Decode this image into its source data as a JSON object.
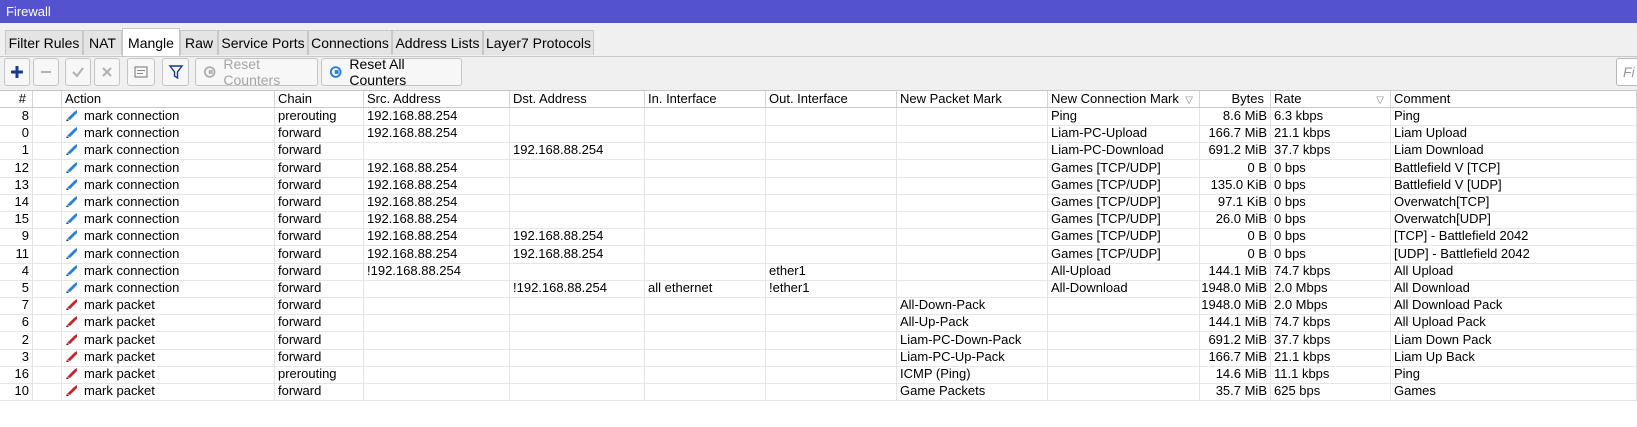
{
  "window": {
    "title": "Firewall"
  },
  "tabs": [
    {
      "label": "Filter Rules",
      "active": false
    },
    {
      "label": "NAT",
      "active": false
    },
    {
      "label": "Mangle",
      "active": true
    },
    {
      "label": "Raw",
      "active": false
    },
    {
      "label": "Service Ports",
      "active": false
    },
    {
      "label": "Connections",
      "active": false
    },
    {
      "label": "Address Lists",
      "active": false
    },
    {
      "label": "Layer7 Protocols",
      "active": false
    }
  ],
  "toolbar": {
    "add_icon": "plus-icon",
    "remove_icon": "minus-icon",
    "enable_icon": "check-icon",
    "disable_icon": "cross-icon",
    "comment_icon": "comment-icon",
    "filter_icon": "filter-icon",
    "reset_counters_label": "Reset Counters",
    "reset_all_counters_label": "Reset All Counters",
    "search_placeholder": "Fi"
  },
  "colors": {
    "titlebar": "#5552cf",
    "accent_blue": "#1a3a8a",
    "connection_icon": "#2b7fd4",
    "packet_icon": "#c0272d"
  },
  "table": {
    "columns": [
      "#",
      "",
      "Action",
      "Chain",
      "Src. Address",
      "Dst. Address",
      "In. Interface",
      "Out. Interface",
      "New Packet Mark",
      "New Connection Mark",
      "Bytes",
      "Rate",
      "Comment"
    ],
    "rows": [
      {
        "num": "8",
        "icon": "connection",
        "action": "mark connection",
        "chain": "prerouting",
        "src": "192.168.88.254",
        "dst": "",
        "in_if": "",
        "out_if": "",
        "pkt_mark": "",
        "conn_mark": "Ping",
        "bytes": "8.6 MiB",
        "rate": "6.3 kbps",
        "comment": "Ping"
      },
      {
        "num": "0",
        "icon": "connection",
        "action": "mark connection",
        "chain": "forward",
        "src": "192.168.88.254",
        "dst": "",
        "in_if": "",
        "out_if": "",
        "pkt_mark": "",
        "conn_mark": "Liam-PC-Upload",
        "bytes": "166.7 MiB",
        "rate": "21.1 kbps",
        "comment": "Liam Upload"
      },
      {
        "num": "1",
        "icon": "connection",
        "action": "mark connection",
        "chain": "forward",
        "src": "",
        "dst": "192.168.88.254",
        "in_if": "",
        "out_if": "",
        "pkt_mark": "",
        "conn_mark": "Liam-PC-Download",
        "bytes": "691.2 MiB",
        "rate": "37.7 kbps",
        "comment": "Liam Download"
      },
      {
        "num": "12",
        "icon": "connection",
        "action": "mark connection",
        "chain": "forward",
        "src": "192.168.88.254",
        "dst": "",
        "in_if": "",
        "out_if": "",
        "pkt_mark": "",
        "conn_mark": "Games [TCP/UDP]",
        "bytes": "0 B",
        "rate": "0 bps",
        "comment": "Battlefield V [TCP]"
      },
      {
        "num": "13",
        "icon": "connection",
        "action": "mark connection",
        "chain": "forward",
        "src": "192.168.88.254",
        "dst": "",
        "in_if": "",
        "out_if": "",
        "pkt_mark": "",
        "conn_mark": "Games [TCP/UDP]",
        "bytes": "135.0 KiB",
        "rate": "0 bps",
        "comment": "Battlefield V [UDP]"
      },
      {
        "num": "14",
        "icon": "connection",
        "action": "mark connection",
        "chain": "forward",
        "src": "192.168.88.254",
        "dst": "",
        "in_if": "",
        "out_if": "",
        "pkt_mark": "",
        "conn_mark": "Games [TCP/UDP]",
        "bytes": "97.1 KiB",
        "rate": "0 bps",
        "comment": "Overwatch[TCP]"
      },
      {
        "num": "15",
        "icon": "connection",
        "action": "mark connection",
        "chain": "forward",
        "src": "192.168.88.254",
        "dst": "",
        "in_if": "",
        "out_if": "",
        "pkt_mark": "",
        "conn_mark": "Games [TCP/UDP]",
        "bytes": "26.0 MiB",
        "rate": "0 bps",
        "comment": "Overwatch[UDP]"
      },
      {
        "num": "9",
        "icon": "connection",
        "action": "mark connection",
        "chain": "forward",
        "src": "192.168.88.254",
        "dst": "192.168.88.254",
        "in_if": "",
        "out_if": "",
        "pkt_mark": "",
        "conn_mark": "Games [TCP/UDP]",
        "bytes": "0 B",
        "rate": "0 bps",
        "comment": "[TCP] - Battlefield 2042"
      },
      {
        "num": "11",
        "icon": "connection",
        "action": "mark connection",
        "chain": "forward",
        "src": "192.168.88.254",
        "dst": "192.168.88.254",
        "in_if": "",
        "out_if": "",
        "pkt_mark": "",
        "conn_mark": "Games [TCP/UDP]",
        "bytes": "0 B",
        "rate": "0 bps",
        "comment": "[UDP] - Battlefield 2042"
      },
      {
        "num": "4",
        "icon": "connection",
        "action": "mark connection",
        "chain": "forward",
        "src": "!192.168.88.254",
        "dst": "",
        "in_if": "",
        "out_if": "ether1",
        "pkt_mark": "",
        "conn_mark": "All-Upload",
        "bytes": "144.1 MiB",
        "rate": "74.7 kbps",
        "comment": "All Upload"
      },
      {
        "num": "5",
        "icon": "connection",
        "action": "mark connection",
        "chain": "forward",
        "src": "",
        "dst": "!192.168.88.254",
        "in_if": "all ethernet",
        "out_if": "!ether1",
        "pkt_mark": "",
        "conn_mark": "All-Download",
        "bytes": "1948.0 MiB",
        "rate": "2.0 Mbps",
        "comment": "All Download"
      },
      {
        "num": "7",
        "icon": "packet",
        "action": "mark packet",
        "chain": "forward",
        "src": "",
        "dst": "",
        "in_if": "",
        "out_if": "",
        "pkt_mark": "All-Down-Pack",
        "conn_mark": "",
        "bytes": "1948.0 MiB",
        "rate": "2.0 Mbps",
        "comment": "All Download Pack"
      },
      {
        "num": "6",
        "icon": "packet",
        "action": "mark packet",
        "chain": "forward",
        "src": "",
        "dst": "",
        "in_if": "",
        "out_if": "",
        "pkt_mark": "All-Up-Pack",
        "conn_mark": "",
        "bytes": "144.1 MiB",
        "rate": "74.7 kbps",
        "comment": "All Upload Pack"
      },
      {
        "num": "2",
        "icon": "packet",
        "action": "mark packet",
        "chain": "forward",
        "src": "",
        "dst": "",
        "in_if": "",
        "out_if": "",
        "pkt_mark": "Liam-PC-Down-Pack",
        "conn_mark": "",
        "bytes": "691.2 MiB",
        "rate": "37.7 kbps",
        "comment": "Liam Down Pack"
      },
      {
        "num": "3",
        "icon": "packet",
        "action": "mark packet",
        "chain": "forward",
        "src": "",
        "dst": "",
        "in_if": "",
        "out_if": "",
        "pkt_mark": "Liam-PC-Up-Pack",
        "conn_mark": "",
        "bytes": "166.7 MiB",
        "rate": "21.1 kbps",
        "comment": "Liam Up Back"
      },
      {
        "num": "16",
        "icon": "packet",
        "action": "mark packet",
        "chain": "prerouting",
        "src": "",
        "dst": "",
        "in_if": "",
        "out_if": "",
        "pkt_mark": "ICMP (Ping)",
        "conn_mark": "",
        "bytes": "14.6 MiB",
        "rate": "11.1 kbps",
        "comment": "Ping"
      },
      {
        "num": "10",
        "icon": "packet",
        "action": "mark packet",
        "chain": "forward",
        "src": "",
        "dst": "",
        "in_if": "",
        "out_if": "",
        "pkt_mark": "Game Packets",
        "conn_mark": "",
        "bytes": "35.7 MiB",
        "rate": "625 bps",
        "comment": "Games"
      }
    ]
  }
}
